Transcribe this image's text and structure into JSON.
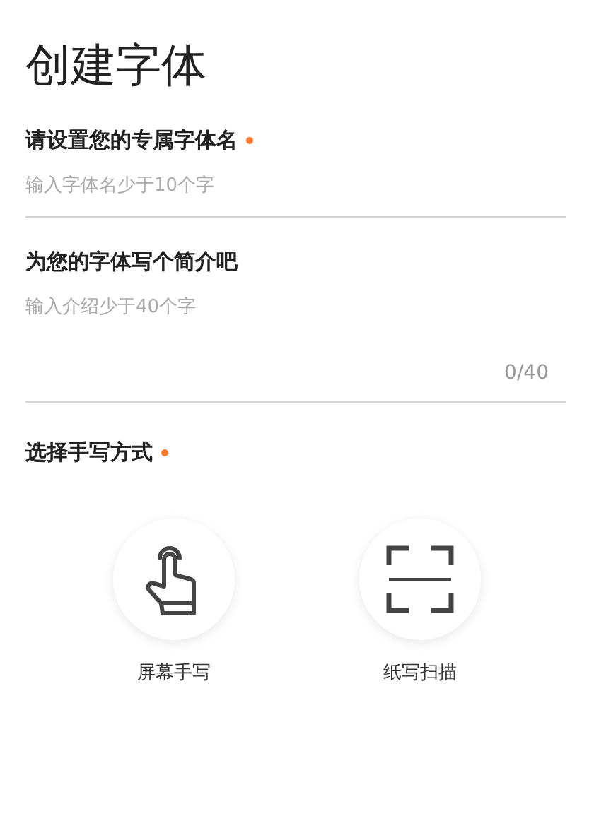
{
  "title": "创建字体",
  "name_field": {
    "label": "请设置您的专属字体名",
    "required": true,
    "placeholder": "输入字体名少于10个字"
  },
  "intro_field": {
    "label": "为您的字体写个简介吧",
    "placeholder": "输入介绍少于40个字",
    "counter": "0/40"
  },
  "method": {
    "label": "选择手写方式",
    "required": true,
    "options": [
      {
        "kind": "touch",
        "label": "屏幕手写"
      },
      {
        "kind": "scan",
        "label": "纸写扫描"
      }
    ]
  }
}
